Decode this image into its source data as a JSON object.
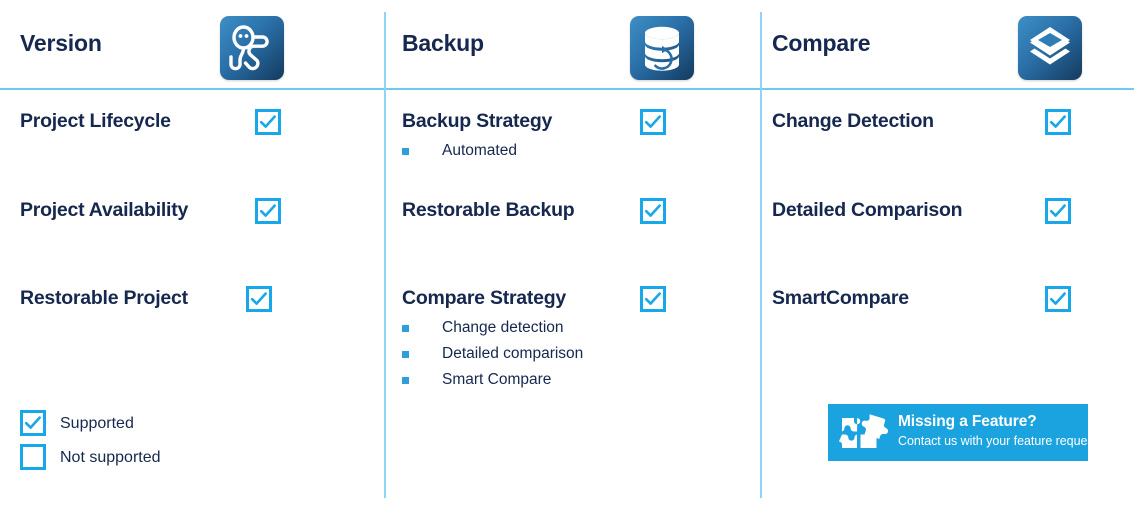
{
  "theme": {
    "navy": "#16284F",
    "accent_blue": "#18A7E8",
    "rule_blue": "#8ED5F5",
    "banner_blue": "#1AA3DF",
    "bullet_blue": "#2F9FDC",
    "icon_gradient_from": "#3E8FC6",
    "icon_gradient_to": "#143A5E"
  },
  "columns": [
    {
      "title": "Version",
      "icon": "version-person-icon",
      "features": [
        {
          "label": "Project Lifecycle",
          "supported": true,
          "bullets": []
        },
        {
          "label": "Project Availability",
          "supported": true,
          "bullets": []
        },
        {
          "label": "Restorable Project",
          "supported": true,
          "bullets": []
        }
      ]
    },
    {
      "title": "Backup",
      "icon": "database-restore-icon",
      "features": [
        {
          "label": "Backup Strategy",
          "supported": true,
          "bullets": [
            "Automated"
          ]
        },
        {
          "label": "Restorable Backup",
          "supported": true,
          "bullets": []
        },
        {
          "label": "Compare Strategy",
          "supported": true,
          "bullets": [
            "Change detection",
            "Detailed comparison",
            "Smart Compare"
          ]
        }
      ]
    },
    {
      "title": "Compare",
      "icon": "layers-stack-icon",
      "features": [
        {
          "label": "Change Detection",
          "supported": true,
          "bullets": []
        },
        {
          "label": "Detailed Comparison",
          "supported": true,
          "bullets": []
        },
        {
          "label": "SmartCompare",
          "supported": true,
          "bullets": []
        }
      ]
    }
  ],
  "legend": {
    "supported_label": "Supported",
    "not_supported_label": "Not supported"
  },
  "banner": {
    "icon": "puzzle-pieces-icon",
    "title": "Missing a Feature?",
    "subtitle": "Contact us with your feature request!"
  }
}
